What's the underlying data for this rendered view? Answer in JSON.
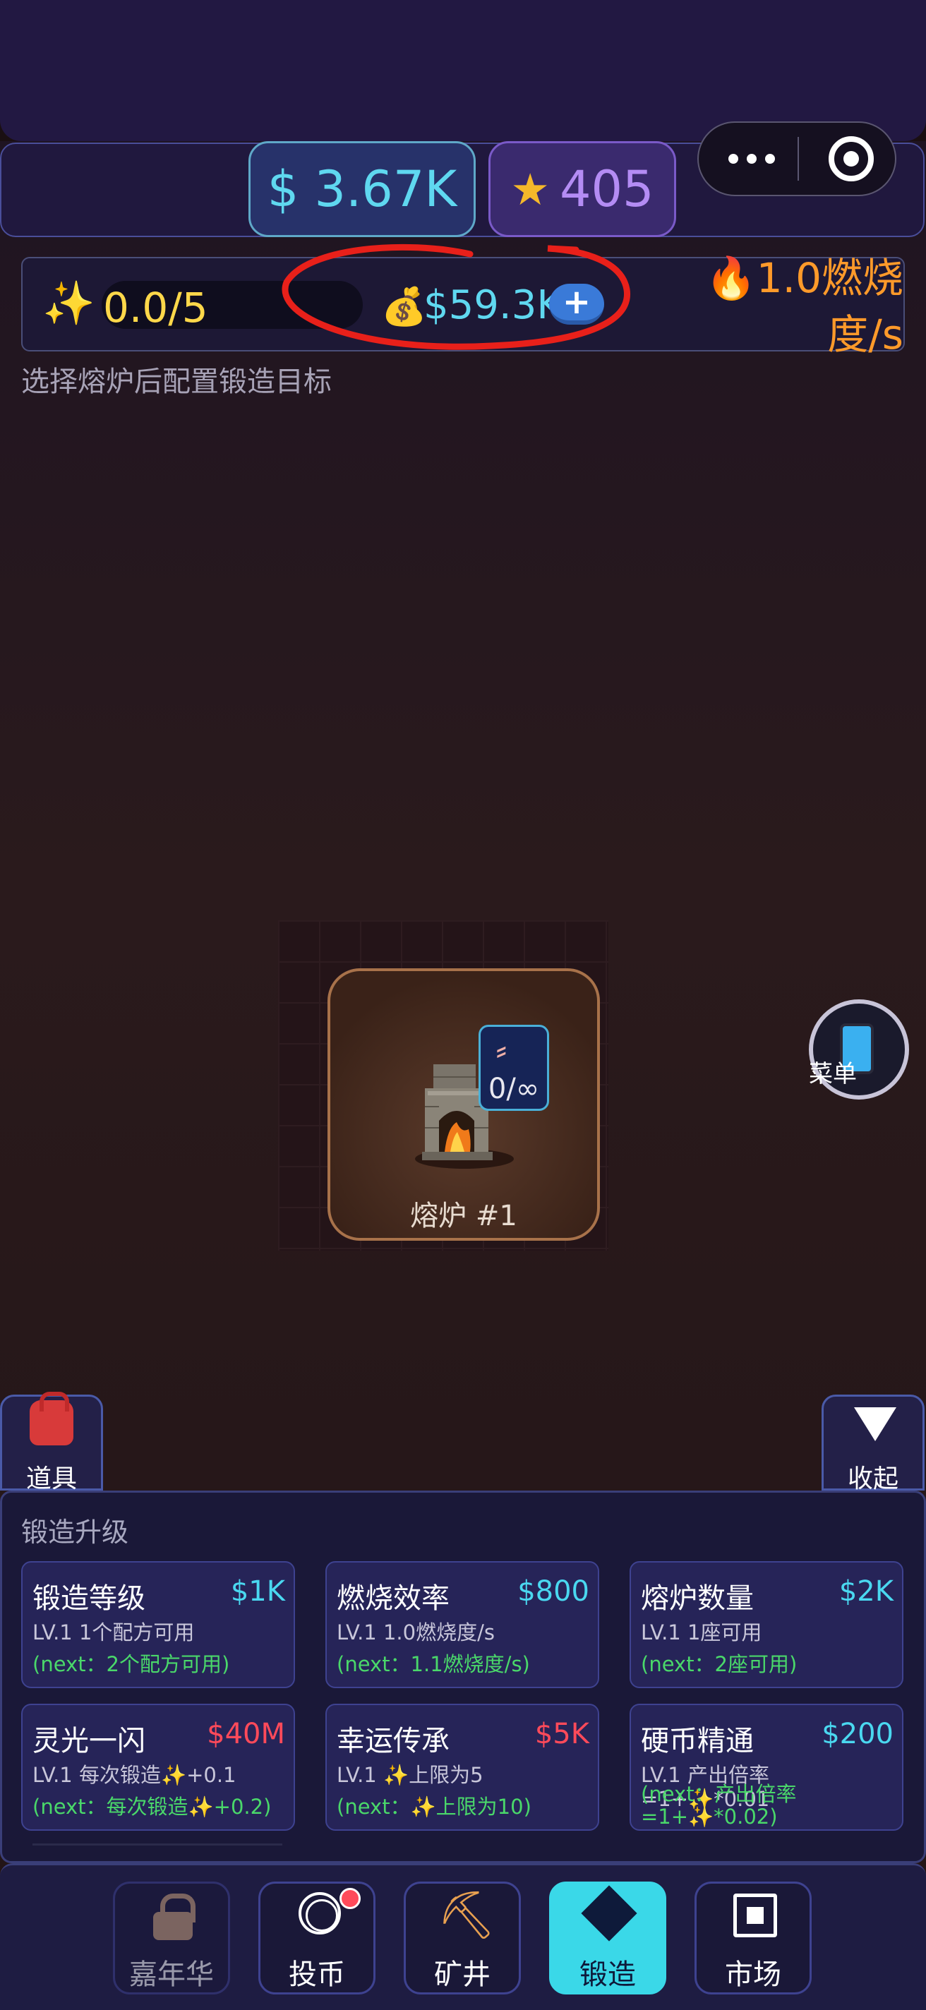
{
  "header": {
    "money": "$ 3.67K",
    "stars": "405",
    "star_icon": "star-icon"
  },
  "status": {
    "progress": "0.0/5",
    "progress_fraction": 0.0,
    "coin_amount": "$59.3K",
    "plus_label": "+",
    "burn_rate_line1": "🔥1.0燃烧",
    "burn_rate_line2": "度/s",
    "hint": "选择熔炉后配置锻造目标"
  },
  "furnace": {
    "label": "熔炉 #1",
    "badge_value": "0/∞"
  },
  "menu": {
    "label": "菜单"
  },
  "side": {
    "items_label": "道具",
    "collapse_label": "收起"
  },
  "upgrades": {
    "title": "锻造升级",
    "cards": [
      {
        "name": "锻造等级",
        "cost": "$1K",
        "desc": "LV.1 1个配方可用",
        "next": "(next：2个配方可用)"
      },
      {
        "name": "燃烧效率",
        "cost": "$800",
        "desc": "LV.1 1.0燃烧度/s",
        "next": "(next：1.1燃烧度/s)"
      },
      {
        "name": "熔炉数量",
        "cost": "$2K",
        "desc": "LV.1 1座可用",
        "next": "(next：2座可用)"
      },
      {
        "name": "灵光一闪",
        "cost": "$40M",
        "desc": "LV.1 每次锻造✨+0.1",
        "next": "(next：每次锻造✨+0.2)"
      },
      {
        "name": "幸运传承",
        "cost": "$5K",
        "desc": "LV.1 ✨上限为5",
        "next": "(next：✨上限为10)"
      },
      {
        "name": "硬币精通",
        "cost": "$200",
        "desc": "LV.1 产出倍率=1+✨*0.01",
        "next": "(next：产出倍率=1+✨*0.02)"
      }
    ]
  },
  "tabs": [
    {
      "label": "嘉年华",
      "icon": "lock-icon"
    },
    {
      "label": "投币",
      "icon": "coin-icon"
    },
    {
      "label": "矿井",
      "icon": "pickaxe-icon"
    },
    {
      "label": "锻造",
      "icon": "diamond-icon",
      "active": true
    },
    {
      "label": "市场",
      "icon": "market-icon"
    }
  ],
  "colors": {
    "accent_cyan": "#4ad8f0",
    "cost_red": "#ff4a5a",
    "next_green": "#4ad86a",
    "burn_orange": "#ff9a2a"
  }
}
